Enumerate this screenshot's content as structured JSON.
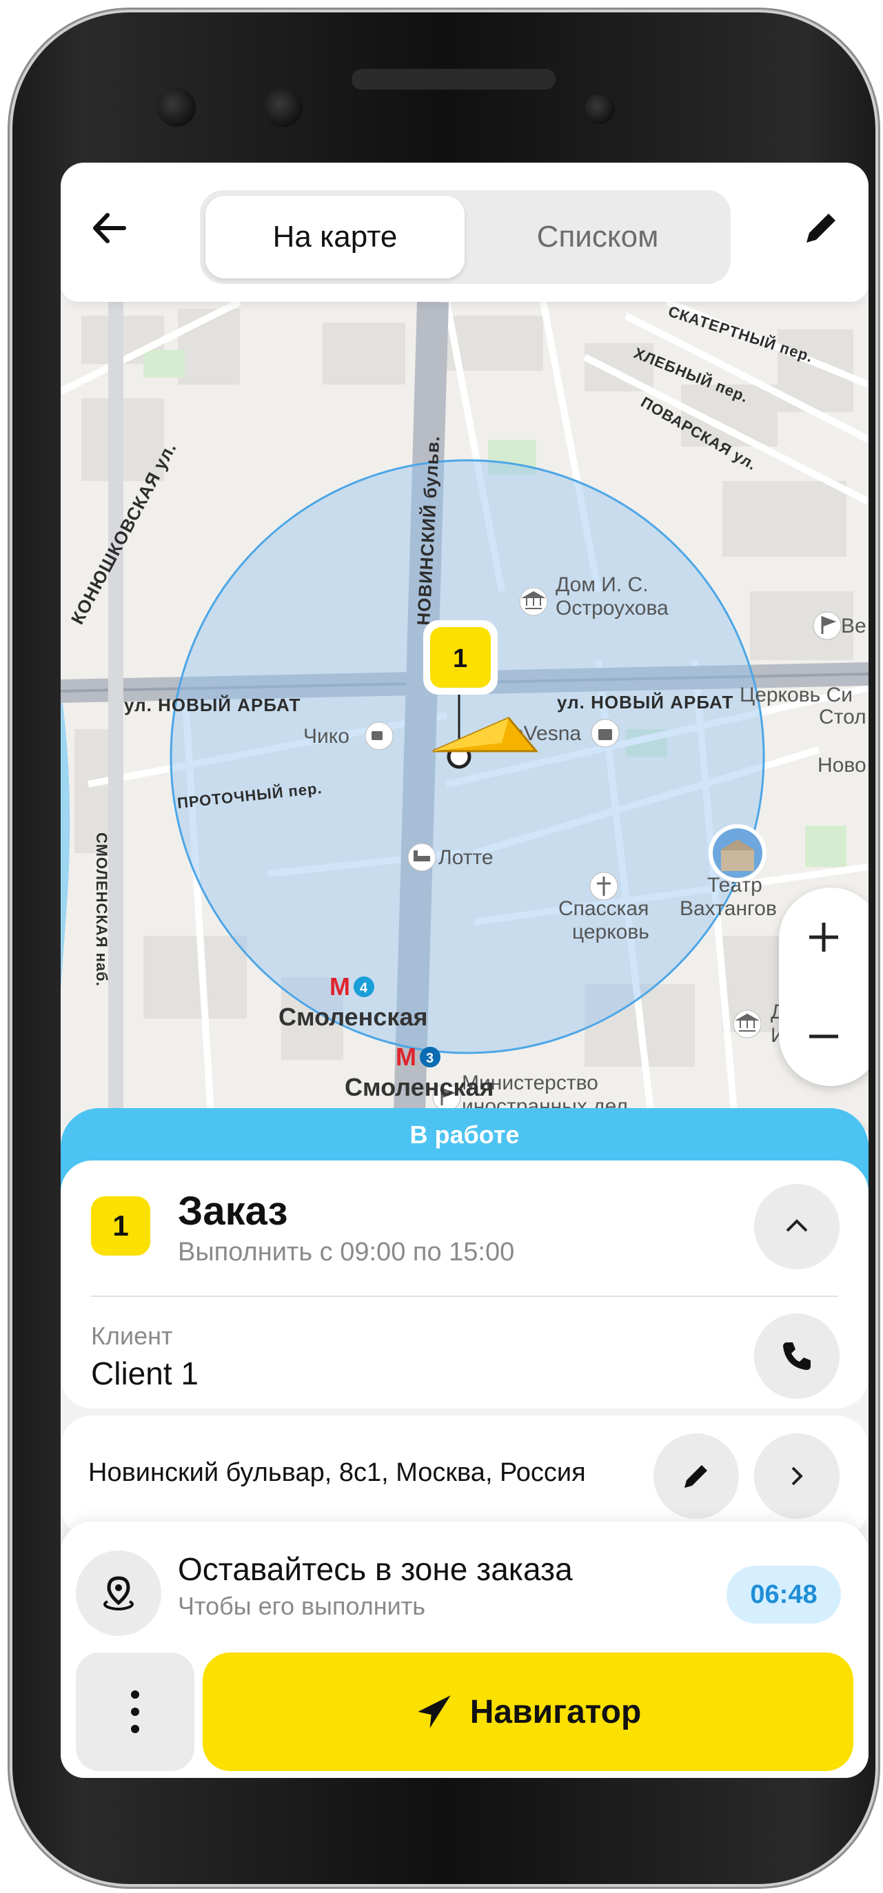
{
  "tabs": {
    "map": "На карте",
    "list": "Списком"
  },
  "map": {
    "streets": {
      "novy_arbat_left": "ул. НОВЫЙ АРБАТ",
      "novy_arbat_right": "ул. НОВЫЙ АРБАТ",
      "novinsky": "НОВИНСКИЙ бульв.",
      "konyushkovskaya": "КОНЮШКОВСКАЯ ул.",
      "skaterny": "СКАТЕРТНЫЙ пер.",
      "khlebny": "ХЛЕБНЫЙ пер.",
      "povarskaya": "ПОВАРСКАЯ ул.",
      "protochny": "ПРОТОЧНЫЙ пер.",
      "smolenskaya_nab": "СМОЛЕНСКАЯ наб."
    },
    "pois": {
      "dom_line1": "Дом И. С.",
      "dom_line2": "Остроухова",
      "ve": "Ве",
      "church_si_1": "Церковь Си",
      "church_si_2": "Стол",
      "chiko": "Чико",
      "vesna": "oVesna",
      "novo": "Ново",
      "lotte": "Лотте",
      "spasskaya_1": "Спасская",
      "spasskaya_2": "церковь",
      "teatr_1": "Театр",
      "teatr_2": "Вахтангов",
      "smolenskaya_4": "Смоленская",
      "smolenskaya_3": "Смоленская",
      "metro_line_4": "4",
      "metro_line_3": "3",
      "metro_letter": "М",
      "ministry_1": "Министерство",
      "ministry_2": "иностранных дел",
      "di_1": "Д",
      "di_2": "И."
    },
    "order_marker": "1"
  },
  "sheet": {
    "status": "В работе",
    "order": {
      "number": "1",
      "title": "Заказ",
      "subtitle": "Выполнить с 09:00 по 15:00"
    },
    "client": {
      "label": "Клиент",
      "name": "Client 1"
    },
    "address": "Новинский бульвар, 8с1, Москва, Россия",
    "zone": {
      "title": "Оставайтесь в зоне заказа",
      "subtitle": "Чтобы его выполнить",
      "timer": "06:48"
    },
    "navigator_label": "Навигатор"
  },
  "colors": {
    "accent_yellow": "#fbe000",
    "status_blue": "#4cc3f2",
    "zone_fill": "#cfe3f7"
  }
}
